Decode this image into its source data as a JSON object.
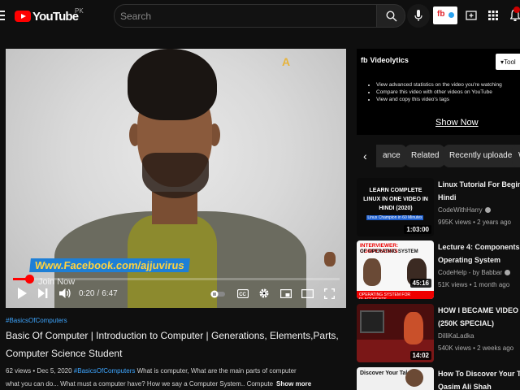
{
  "header": {
    "logo_text": "YouTube",
    "country": "PK",
    "search_placeholder": "Search",
    "extension_label": "fb"
  },
  "player": {
    "watermark_a": "A",
    "watermark_facebook": "Www.Facebook.com/ajjuvirus",
    "watermark_join": "Join Now",
    "current_time": "0:20",
    "time_separator": "/",
    "duration": "6:47",
    "progress_fraction": 0.049
  },
  "video": {
    "hashtag": "#BasicsOfComputers",
    "title": "Basic Of Computer | Introduction to Computer | Generations, Elements,Parts, Computer Science Student",
    "views": "62 views",
    "date": "Dec 5, 2020",
    "separator": "•",
    "desc_tag": "#BasicsOfComputers",
    "desc_line1": "What is computer, What are the main parts of computer",
    "desc_line2": "what you can do... What must a computer have? How we say a Computer System.. Compute",
    "show_more": "Show more"
  },
  "videolytics": {
    "brand_mark": "fb",
    "brand": "Videolytics",
    "tool_label": "Tool",
    "items": [
      "View advanced statistics on the video you're watching",
      "Compare this video with other videos on YouTube",
      "View and copy this video's tags"
    ],
    "show_now": "Show Now"
  },
  "chips": {
    "prev_label": "‹",
    "items": [
      "ance",
      "Related",
      "Recently uploaded",
      "W"
    ]
  },
  "recommendations": [
    {
      "title_l1": "Linux Tutorial For Beginners In",
      "title_l2": "Hindi",
      "channel": "CodeWithHarry",
      "views": "995K views",
      "age": "2 years ago",
      "duration": "1:03:00",
      "thumb_text": "LEARN COMPLETE LINUX IN ONE VIDEO IN HINDI (2020)",
      "thumb_sub": "Linux Champion in 60 Minutes"
    },
    {
      "title_l1": "Lecture 4: Components of",
      "title_l2": "Operating System",
      "channel": "CodeHelp - by Babbar",
      "views": "51K views",
      "age": "1 month ago",
      "duration": "45:16",
      "thumb_text": "INTERVIEWER: COMPONENTS",
      "thumb_text2": "OF OPERATING SYSTEM",
      "thumb_sub": "OPERATING SYSTEM FOR PLACEMENTS"
    },
    {
      "title_l1": "HOW I BECAME VIDEO EDITOR",
      "title_l2": "(250K SPECIAL)",
      "channel": "DilliKaLadka",
      "views": "540K views",
      "age": "2 weeks ago",
      "duration": "14:02"
    },
    {
      "title_l1": "How To Discover Your Talent",
      "title_l2": "Qasim Ali Shah",
      "thumb_text": "Discover Your Talent"
    }
  ]
}
